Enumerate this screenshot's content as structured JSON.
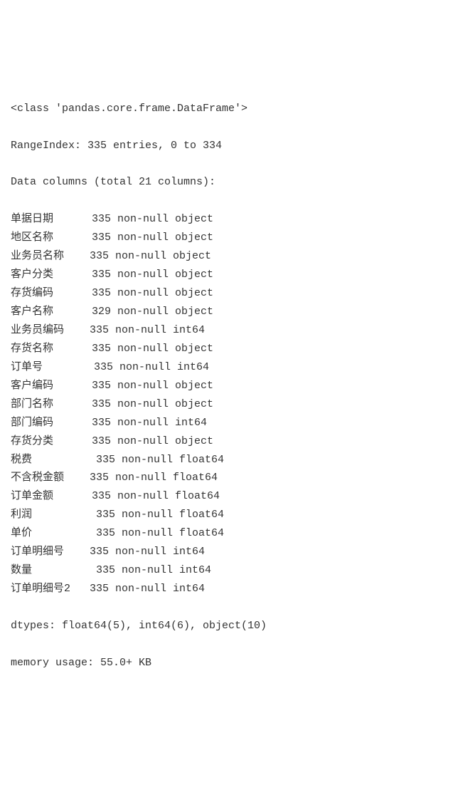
{
  "header": {
    "class_line": "<class 'pandas.core.frame.DataFrame'>",
    "range_index": "RangeIndex: 335 entries, 0 to 334",
    "data_columns": "Data columns (total 21 columns):"
  },
  "columns": [
    {
      "name": "单据日期",
      "info": "335 non-null object"
    },
    {
      "name": "地区名称",
      "info": "335 non-null object"
    },
    {
      "name": "业务员名称",
      "info": "335 non-null object"
    },
    {
      "name": "客户分类",
      "info": "335 non-null object"
    },
    {
      "name": "存货编码",
      "info": "335 non-null object"
    },
    {
      "name": "客户名称",
      "info": "329 non-null object"
    },
    {
      "name": "业务员编码",
      "info": "335 non-null int64"
    },
    {
      "name": "存货名称",
      "info": "335 non-null object"
    },
    {
      "name": "订单号",
      "info": "335 non-null int64"
    },
    {
      "name": "客户编码",
      "info": "335 non-null object"
    },
    {
      "name": "部门名称",
      "info": "335 non-null object"
    },
    {
      "name": "部门编码",
      "info": "335 non-null int64"
    },
    {
      "name": "存货分类",
      "info": "335 non-null object"
    },
    {
      "name": "税费",
      "info": "335 non-null float64"
    },
    {
      "name": "不含税金额",
      "info": "335 non-null float64"
    },
    {
      "name": "订单金额",
      "info": "335 non-null float64"
    },
    {
      "name": "利润",
      "info": "335 non-null float64"
    },
    {
      "name": "单价",
      "info": "335 non-null float64"
    },
    {
      "name": "订单明细号",
      "info": "335 non-null int64"
    },
    {
      "name": "数量",
      "info": "335 non-null int64"
    },
    {
      "name": "订单明细号2",
      "info": "335 non-null int64"
    }
  ],
  "footer": {
    "dtypes": "dtypes: float64(5), int64(6), object(10)",
    "memory": "memory usage: 55.0+ KB"
  }
}
